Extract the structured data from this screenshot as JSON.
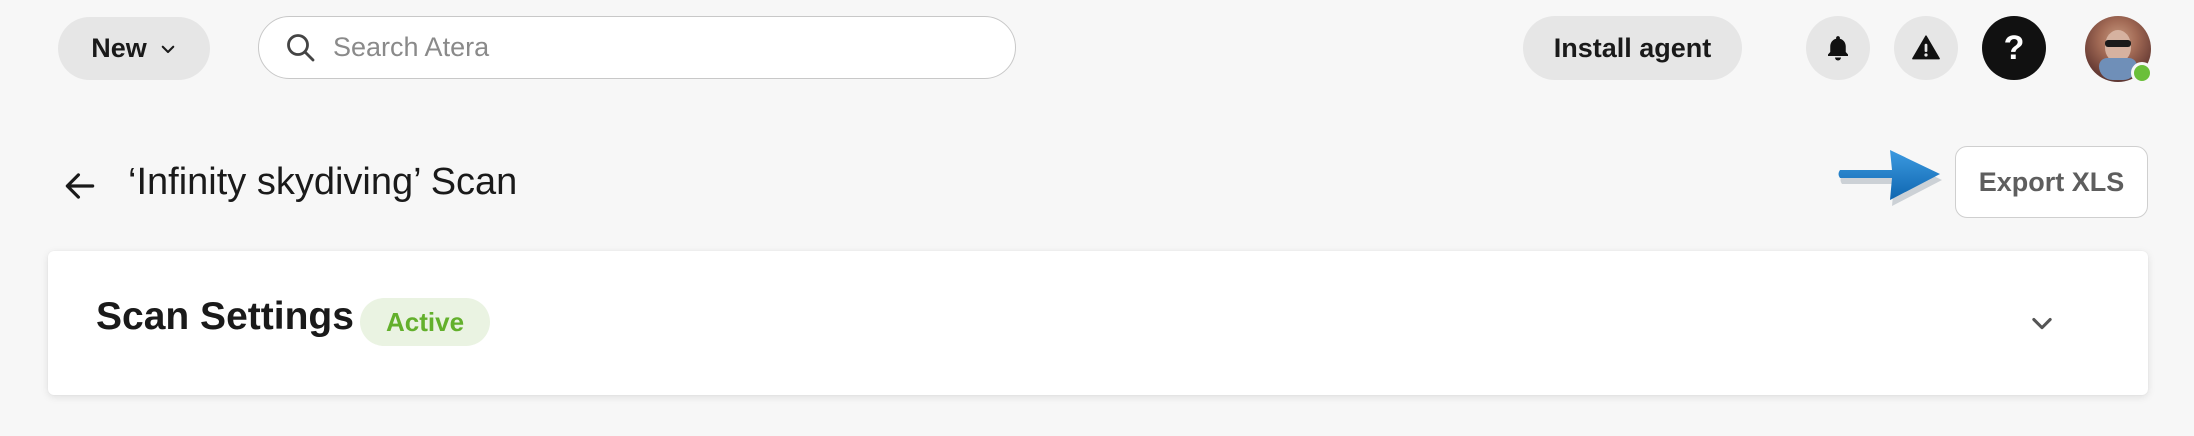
{
  "header": {
    "new_label": "New",
    "search_placeholder": "Search Atera",
    "install_label": "Install agent",
    "help_label": "?",
    "icons": [
      "chevron-down-icon",
      "search-icon",
      "bell-icon",
      "warning-icon",
      "help-icon",
      "avatar"
    ]
  },
  "page": {
    "title": "‘Infinity skydiving’ Scan",
    "export_label": "Export XLS"
  },
  "card": {
    "title": "Scan Settings",
    "status": "Active"
  },
  "colors": {
    "background": "#f7f7f7",
    "badge_text": "#63b02c",
    "badge_bg": "#eaf3e2",
    "annotation_arrow": "#1a78c2",
    "online_status": "#6bbf3a"
  }
}
